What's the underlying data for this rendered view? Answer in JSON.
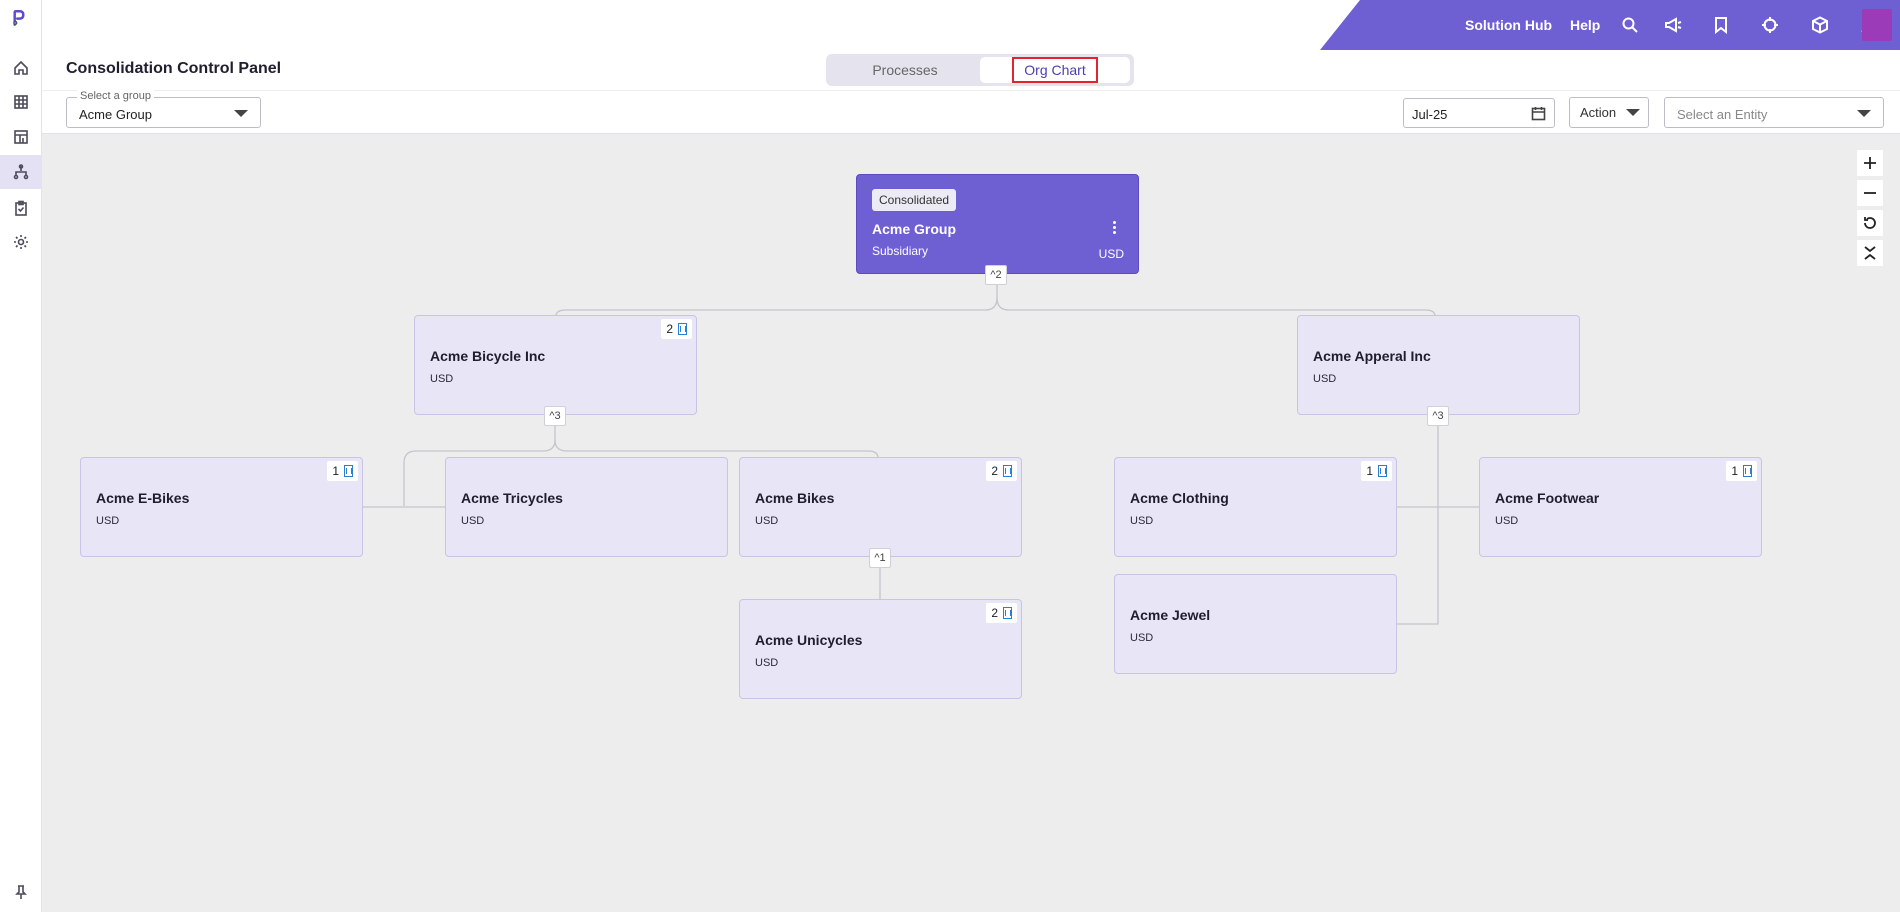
{
  "app": {
    "page_title": "Consolidation Control Panel",
    "tabs": [
      {
        "label": "Processes"
      },
      {
        "label": "Org Chart"
      }
    ]
  },
  "topbar": {
    "solution_hub": "Solution Hub",
    "help": "Help",
    "icons": [
      "search-icon",
      "megaphone-icon",
      "bookmark-icon",
      "crosshair-icon",
      "cube-icon",
      "bell-icon"
    ]
  },
  "sidebar": {
    "items": [
      "home-icon",
      "grid-icon",
      "dashboard-icon",
      "org-hierarchy-icon",
      "clipboard-icon",
      "settings-icon"
    ],
    "pin": "pin-icon"
  },
  "filters": {
    "group_label": "Select a group",
    "group_value": "Acme Group",
    "date_value": "Jul-25",
    "action_label": "Action",
    "entity_placeholder": "Select an Entity"
  },
  "org": {
    "root": {
      "tag": "Consolidated",
      "name": "Acme Group",
      "type": "Subsidiary",
      "currency": "USD",
      "children_count": "^2"
    },
    "nodes": [
      {
        "name": "Acme Bicycle Inc",
        "currency": "USD",
        "badge": "2",
        "toggle": "^3"
      },
      {
        "name": "Acme Apperal Inc",
        "currency": "USD",
        "toggle": "^3"
      },
      {
        "name": "Acme E-Bikes",
        "currency": "USD",
        "badge": "1"
      },
      {
        "name": "Acme Tricycles",
        "currency": "USD"
      },
      {
        "name": "Acme Bikes",
        "currency": "USD",
        "badge": "2",
        "toggle": "^1"
      },
      {
        "name": "Acme Unicycles",
        "currency": "USD",
        "badge": "2"
      },
      {
        "name": "Acme Clothing",
        "currency": "USD",
        "badge": "1"
      },
      {
        "name": "Acme Footwear",
        "currency": "USD",
        "badge": "1"
      },
      {
        "name": "Acme Jewel",
        "currency": "USD"
      }
    ]
  },
  "colors": {
    "brand": "#6e5fd3",
    "node_fill": "#e8e5f7",
    "canvas": "#ededed",
    "highlight": "#e0252f"
  }
}
